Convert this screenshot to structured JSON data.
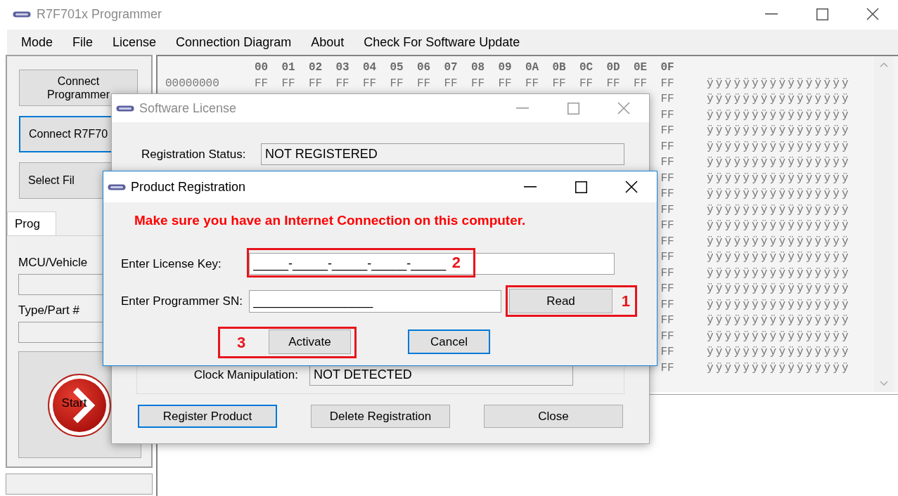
{
  "window": {
    "title": "R7F701x Programmer"
  },
  "menu": [
    "Mode",
    "File",
    "License",
    "Connection Diagram",
    "About",
    "Check For Software Update"
  ],
  "sidebar": {
    "buttons": [
      {
        "lines": [
          "Connect",
          "Programmer"
        ],
        "focused": false
      },
      {
        "lines": [
          "Connect R7F70"
        ],
        "focused": true
      },
      {
        "lines": [
          "Select Fil"
        ],
        "focused": false
      }
    ],
    "tabs": [
      {
        "label": "Prog",
        "selected": true
      }
    ],
    "fields": [
      {
        "label": "MCU/Vehicle"
      },
      {
        "label": "Type/Part #"
      }
    ],
    "start_button": {
      "label": "Start"
    }
  },
  "hex_view": {
    "columns": [
      "00",
      "01",
      "02",
      "03",
      "04",
      "05",
      "06",
      "07",
      "08",
      "09",
      "0A",
      "0B",
      "0C",
      "0D",
      "0E",
      "0F"
    ],
    "rows": [
      {
        "address": "00000000",
        "bytes": [
          "FF",
          "FF",
          "FF",
          "FF",
          "FF",
          "FF",
          "FF",
          "FF",
          "FF",
          "FF",
          "FF",
          "FF",
          "FF",
          "FF",
          "FF",
          "FF"
        ],
        "ascii": "ÿÿÿÿÿÿÿÿÿÿÿÿÿÿÿÿ"
      },
      {
        "bytes": [
          "FF"
        ],
        "ascii": "ÿÿÿÿÿÿÿÿÿÿÿÿÿÿÿÿ"
      },
      {
        "bytes": [
          "FF"
        ],
        "ascii": "ÿÿÿÿÿÿÿÿÿÿÿÿÿÿÿÿ"
      },
      {
        "bytes": [
          "FF"
        ],
        "ascii": "ÿÿÿÿÿÿÿÿÿÿÿÿÿÿÿÿ"
      },
      {
        "bytes": [
          "FF"
        ],
        "ascii": "ÿÿÿÿÿÿÿÿÿÿÿÿÿÿÿÿ"
      },
      {
        "bytes": [
          "FF"
        ],
        "ascii": "ÿÿÿÿÿÿÿÿÿÿÿÿÿÿÿÿ"
      },
      {
        "bytes": [
          "FF"
        ],
        "ascii": "ÿÿÿÿÿÿÿÿÿÿÿÿÿÿÿÿ"
      },
      {
        "bytes": [
          "FF"
        ],
        "ascii": "ÿÿÿÿÿÿÿÿÿÿÿÿÿÿÿÿ"
      },
      {
        "bytes": [
          "FF"
        ],
        "ascii": "ÿÿÿÿÿÿÿÿÿÿÿÿÿÿÿÿ"
      },
      {
        "bytes": [
          "FF"
        ],
        "ascii": "ÿÿÿÿÿÿÿÿÿÿÿÿÿÿÿÿ"
      },
      {
        "bytes": [
          "FF"
        ],
        "ascii": "ÿÿÿÿÿÿÿÿÿÿÿÿÿÿÿÿ"
      },
      {
        "bytes": [
          "FF"
        ],
        "ascii": "ÿÿÿÿÿÿÿÿÿÿÿÿÿÿÿÿ"
      },
      {
        "bytes": [
          "FF"
        ],
        "ascii": "ÿÿÿÿÿÿÿÿÿÿÿÿÿÿÿÿ"
      },
      {
        "bytes": [
          "FF"
        ],
        "ascii": "ÿÿÿÿÿÿÿÿÿÿÿÿÿÿÿÿ"
      },
      {
        "bytes": [
          "FF"
        ],
        "ascii": "ÿÿÿÿÿÿÿÿÿÿÿÿÿÿÿÿ"
      },
      {
        "bytes": [
          "FF"
        ],
        "ascii": "ÿÿÿÿÿÿÿÿÿÿÿÿÿÿÿÿ"
      },
      {
        "bytes": [
          "FF"
        ],
        "ascii": "ÿÿÿÿÿÿÿÿÿÿÿÿÿÿÿÿ"
      },
      {
        "bytes": [
          "FF"
        ],
        "ascii": "ÿÿÿÿÿÿÿÿÿÿÿÿÿÿÿÿ"
      },
      {
        "bytes": [
          "FF"
        ],
        "ascii": "ÿÿÿÿÿÿÿÿÿÿÿÿÿÿÿÿ"
      }
    ]
  },
  "license_dialog": {
    "title": "Software License",
    "active": false,
    "registration_status": {
      "label": "Registration Status:",
      "value": "NOT REGISTERED"
    },
    "clock_manipulation": {
      "label": "Clock Manipulation:",
      "value": "NOT DETECTED"
    },
    "buttons": [
      {
        "label": "Register Product",
        "focused": true
      },
      {
        "label": "Delete Registration",
        "focused": false
      },
      {
        "label": "Close",
        "focused": false
      }
    ]
  },
  "registration_dialog": {
    "title": "Product Registration",
    "active": true,
    "notice": "Make sure you have an Internet Connection on this computer.",
    "license_key": {
      "label": "Enter License Key:",
      "value": "_____-_____-_____-_____-_____",
      "annotation": "2"
    },
    "programmer_sn": {
      "label": "Enter Programmer SN:",
      "value": "_________________"
    },
    "read_button": {
      "label": "Read",
      "annotation": "1"
    },
    "buttons": [
      {
        "label": "Activate",
        "focused": false,
        "annotation": "3"
      },
      {
        "label": "Cancel",
        "focused": true
      }
    ]
  }
}
